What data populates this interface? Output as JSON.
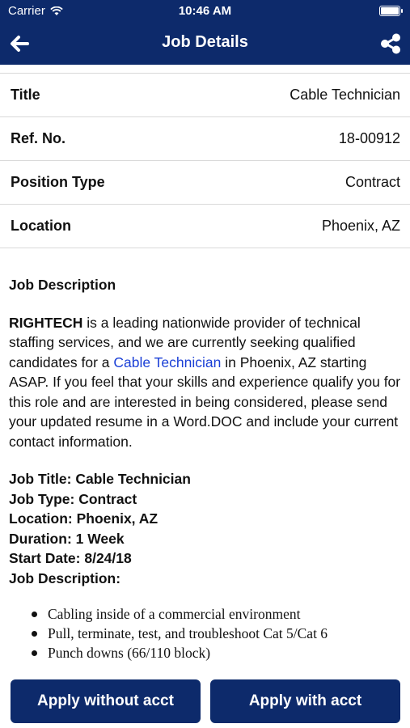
{
  "status": {
    "carrier": "Carrier",
    "time": "10:46 AM"
  },
  "nav": {
    "title": "Job Details",
    "back_icon": "arrow-left-icon",
    "share_icon": "share-icon"
  },
  "details": [
    {
      "label": "Title",
      "value": "Cable Technician"
    },
    {
      "label": "Ref. No.",
      "value": "18-00912"
    },
    {
      "label": "Position Type",
      "value": "Contract"
    },
    {
      "label": "Location",
      "value": "Phoenix, AZ"
    }
  ],
  "description": {
    "heading": "Job Description",
    "company": "RIGHTECH",
    "text_1": " is a leading nationwide provider of technical staffing services, and we are currently seeking qualified candidates for a ",
    "link": "Cable Technician",
    "text_2": " in Phoenix, AZ starting ASAP. If you feel that your skills and experience qualify you for this role and are interested in being considered, please send your updated resume in a Word.DOC and include your current contact information.",
    "facts": [
      "Job Title: Cable Technician",
      "Job Type: Contract",
      "Location: Phoenix, AZ",
      "Duration: 1 Week",
      "Start Date: 8/24/18",
      "Job Description:"
    ],
    "bullets": [
      "Cabling inside of a commercial environment",
      "Pull, terminate, test, and troubleshoot Cat 5/Cat 6",
      "Punch downs (66/110 block)"
    ]
  },
  "actions": {
    "apply_without": "Apply without acct",
    "apply_with": "Apply with acct"
  },
  "colors": {
    "brand": "#0d2a6b",
    "link": "#1a3fd6"
  }
}
